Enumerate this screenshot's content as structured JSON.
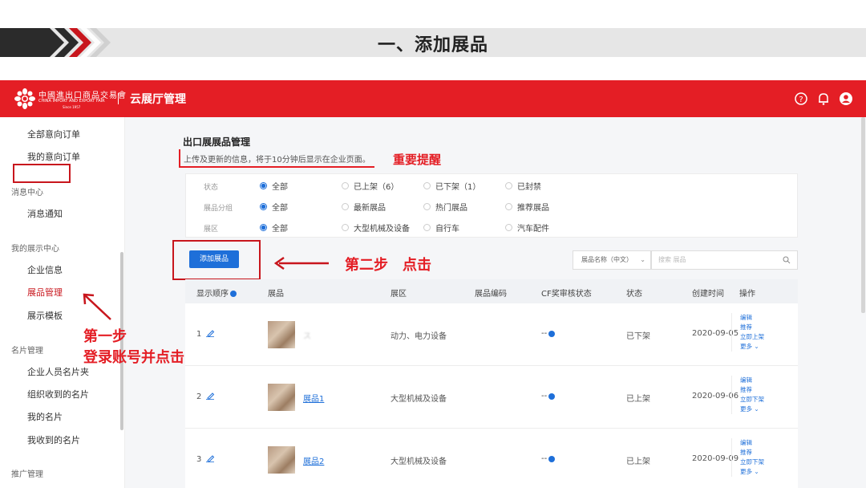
{
  "slide": {
    "title": "一、添加展品"
  },
  "topbar": {
    "logo_cn": "中國進出口商品交易會",
    "logo_en": "CHINA IMPORT AND EXPORT FAIR",
    "logo_since": "Since 1957",
    "app_title": "云展厅管理",
    "icons": [
      "help-icon",
      "bell-icon",
      "user-icon"
    ],
    "brand_color": "#e41e25"
  },
  "sidebar": {
    "items": [
      {
        "label": "全部意向订单",
        "type": "item"
      },
      {
        "label": "我的意向订单",
        "type": "item"
      },
      {
        "label": "消息中心",
        "type": "group"
      },
      {
        "label": "消息通知",
        "type": "item"
      },
      {
        "label": "我的展示中心",
        "type": "group"
      },
      {
        "label": "企业信息",
        "type": "item"
      },
      {
        "label": "展品管理",
        "type": "item",
        "active": true
      },
      {
        "label": "展示模板",
        "type": "item"
      },
      {
        "label": "名片管理",
        "type": "group"
      },
      {
        "label": "企业人员名片夹",
        "type": "item"
      },
      {
        "label": "组织收到的名片",
        "type": "item"
      },
      {
        "label": "我的名片",
        "type": "item"
      },
      {
        "label": "我收到的名片",
        "type": "item"
      },
      {
        "label": "推广管理",
        "type": "group"
      }
    ]
  },
  "main": {
    "page_title": "出口展展品管理",
    "notice": "上传及更新的信息，将于10分钟后显示在企业页面。",
    "reminder": "重要提醒",
    "filters": [
      {
        "label": "状态",
        "options": [
          "全部",
          "已上架（6）",
          "已下架（1）",
          "已封禁"
        ],
        "selected": 0
      },
      {
        "label": "展品分组",
        "options": [
          "全部",
          "最新展品",
          "热门展品",
          "推荐展品"
        ],
        "selected": 0
      },
      {
        "label": "展区",
        "options": [
          "全部",
          "大型机械及设备",
          "自行车",
          "汽车配件"
        ],
        "selected": 0
      }
    ],
    "add_button": "添加展品",
    "step2": "第二步　点击",
    "search": {
      "select_value": "展品名称（中文）",
      "placeholder": "搜索 展品"
    },
    "table": {
      "headers": [
        "显示顺序",
        "展品",
        "展区",
        "展品编码",
        "CF奖审核状态",
        "状态",
        "创建时间",
        "操作"
      ],
      "rows": [
        {
          "order": "1",
          "name": "ス",
          "zone": "动力、电力设备",
          "code": "",
          "cf": "--",
          "status": "已下架",
          "created": "2020-09-05",
          "ops": [
            "编辑",
            "推荐",
            "立即上架",
            "更多"
          ]
        },
        {
          "order": "2",
          "name": "展品1",
          "zone": "大型机械及设备",
          "code": "",
          "cf": "--",
          "status": "已上架",
          "created": "2020-09-06",
          "ops": [
            "编辑",
            "推荐",
            "立即下架",
            "更多"
          ]
        },
        {
          "order": "3",
          "name": "展品2",
          "zone": "大型机械及设备",
          "code": "",
          "cf": "--",
          "status": "已上架",
          "created": "2020-09-09",
          "ops": [
            "编辑",
            "推荐",
            "立即下架",
            "更多"
          ]
        }
      ]
    }
  },
  "annotations": {
    "step1_line1": "第一步",
    "step1_line2": "登录账号并点击"
  }
}
